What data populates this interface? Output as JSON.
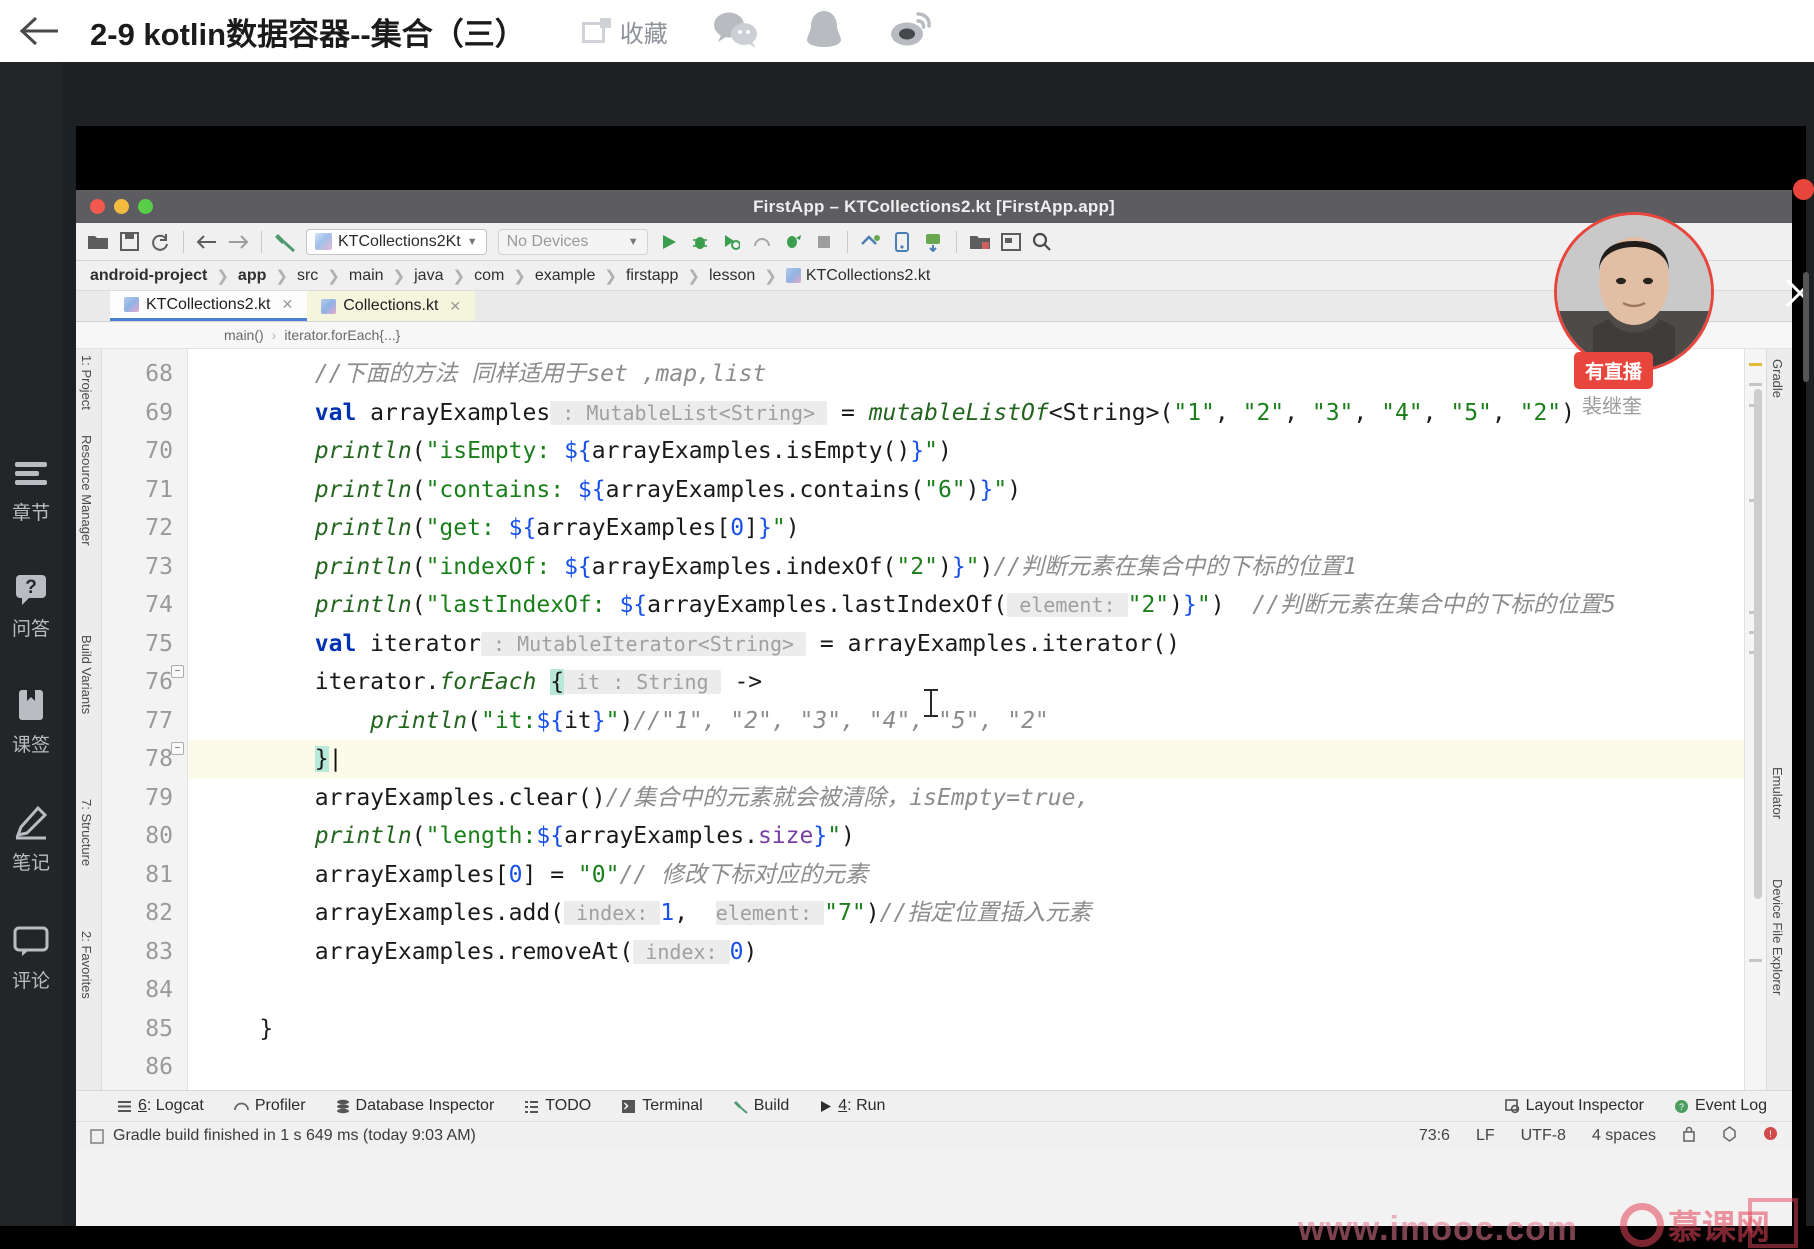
{
  "header": {
    "back_icon": "arrow-left-icon",
    "title": "2-9 kotlin数据容器--集合（三）",
    "favorite_label": "收藏",
    "social": [
      {
        "name": "wechat-icon"
      },
      {
        "name": "qq-icon"
      },
      {
        "name": "weibo-icon"
      }
    ]
  },
  "sidebar": {
    "items": [
      {
        "icon": "chapters-icon",
        "label": "章节"
      },
      {
        "icon": "qa-icon",
        "label": "问答"
      },
      {
        "icon": "bookmark-icon",
        "label": "课签"
      },
      {
        "icon": "notes-icon",
        "label": "笔记"
      },
      {
        "icon": "comments-icon",
        "label": "评论"
      }
    ]
  },
  "overlay": {
    "live_badge": "有直播",
    "presenter_name": "裴继奎",
    "close_icon": "close-icon"
  },
  "ide": {
    "window_title": "FirstApp – KTCollections2.kt [FirstApp.app]",
    "toolbar": {
      "icons": [
        "open-folder-icon",
        "save-icon",
        "sync-icon",
        "back-icon",
        "forward-icon",
        "build-hammer-icon"
      ],
      "run_config": "KTCollections2Kt",
      "device_selector": "No Devices",
      "action_icons": [
        "run-icon",
        "debug-icon",
        "run-coverage-icon",
        "profile-icon",
        "attach-debugger-icon",
        "stop-icon",
        "avd-manager-icon",
        "device-manager-icon",
        "sdk-manager-icon",
        "project-structure-icon",
        "layout-editor-icon",
        "search-icon"
      ]
    },
    "breadcrumbs": [
      "android-project",
      "app",
      "src",
      "main",
      "java",
      "com",
      "example",
      "firstapp",
      "lesson",
      "KTCollections2.kt"
    ],
    "tabs": [
      {
        "label": "KTCollections2.kt",
        "active": true
      },
      {
        "label": "Collections.kt",
        "active": false
      }
    ],
    "structure_path": [
      "main()",
      "iterator.forEach{...}"
    ],
    "left_tool_labels": [
      "1: Project",
      "Resource Manager",
      "Build Variants",
      "7: Structure",
      "2: Favorites"
    ],
    "right_tool_labels": [
      "Gradle",
      "Emulator",
      "Device File Explorer"
    ],
    "bottom_tabs": [
      {
        "num": "6",
        "label": "Logcat",
        "icon": "logcat-icon"
      },
      {
        "num": "",
        "label": "Profiler",
        "icon": "profiler-icon"
      },
      {
        "num": "",
        "label": "Database Inspector",
        "icon": "database-icon"
      },
      {
        "num": "",
        "label": "TODO",
        "icon": "todo-icon"
      },
      {
        "num": "",
        "label": "Terminal",
        "icon": "terminal-icon"
      },
      {
        "num": "",
        "label": "Build",
        "icon": "build-icon"
      },
      {
        "num": "4",
        "label": "Run",
        "icon": "run-icon"
      }
    ],
    "bottom_right": [
      {
        "label": "Layout Inspector",
        "icon": "layout-inspector-icon"
      },
      {
        "label": "Event Log",
        "icon": "event-log-icon"
      }
    ],
    "status_message": "Gradle build finished in 1 s 649 ms (today 9:03 AM)",
    "status_right": {
      "caret": "73:6",
      "line_sep": "LF",
      "encoding": "UTF-8",
      "indent": "4 spaces",
      "lock_icon": "lock-icon",
      "inspector_icon": "inspection-icon",
      "error_icon": "error-icon"
    },
    "editor": {
      "first_line": 68,
      "highlight_line": 78,
      "lines": [
        {
          "n": 68,
          "segments": [
            {
              "t": "        ",
              "c": "plain"
            },
            {
              "t": "//下面的方法 同样适用于set ,map,list",
              "c": "cmt"
            }
          ]
        },
        {
          "n": 69,
          "segments": [
            {
              "t": "        ",
              "c": "plain"
            },
            {
              "t": "val",
              "c": "kw"
            },
            {
              "t": " arrayExamples",
              "c": "plain"
            },
            {
              "t": " : MutableList<String> ",
              "c": "hint"
            },
            {
              "t": " = ",
              "c": "plain"
            },
            {
              "t": "mutableListOf",
              "c": "fn"
            },
            {
              "t": "<String>(",
              "c": "plain"
            },
            {
              "t": "\"1\"",
              "c": "str"
            },
            {
              "t": ", ",
              "c": "plain"
            },
            {
              "t": "\"2\"",
              "c": "str"
            },
            {
              "t": ", ",
              "c": "plain"
            },
            {
              "t": "\"3\"",
              "c": "str"
            },
            {
              "t": ", ",
              "c": "plain"
            },
            {
              "t": "\"4\"",
              "c": "str"
            },
            {
              "t": ", ",
              "c": "plain"
            },
            {
              "t": "\"5\"",
              "c": "str"
            },
            {
              "t": ", ",
              "c": "plain"
            },
            {
              "t": "\"2\"",
              "c": "str"
            },
            {
              "t": ")",
              "c": "plain"
            }
          ]
        },
        {
          "n": 70,
          "segments": [
            {
              "t": "        ",
              "c": "plain"
            },
            {
              "t": "println",
              "c": "fn"
            },
            {
              "t": "(",
              "c": "plain"
            },
            {
              "t": "\"isEmpty: ",
              "c": "str"
            },
            {
              "t": "${",
              "c": "num"
            },
            {
              "t": "arrayExamples.isEmpty()",
              "c": "plain"
            },
            {
              "t": "}",
              "c": "num"
            },
            {
              "t": "\"",
              "c": "str"
            },
            {
              "t": ")",
              "c": "plain"
            }
          ]
        },
        {
          "n": 71,
          "segments": [
            {
              "t": "        ",
              "c": "plain"
            },
            {
              "t": "println",
              "c": "fn"
            },
            {
              "t": "(",
              "c": "plain"
            },
            {
              "t": "\"contains: ",
              "c": "str"
            },
            {
              "t": "${",
              "c": "num"
            },
            {
              "t": "arrayExamples.contains(",
              "c": "plain"
            },
            {
              "t": "\"6\"",
              "c": "str"
            },
            {
              "t": ")",
              "c": "plain"
            },
            {
              "t": "}",
              "c": "num"
            },
            {
              "t": "\"",
              "c": "str"
            },
            {
              "t": ")",
              "c": "plain"
            }
          ]
        },
        {
          "n": 72,
          "segments": [
            {
              "t": "        ",
              "c": "plain"
            },
            {
              "t": "println",
              "c": "fn"
            },
            {
              "t": "(",
              "c": "plain"
            },
            {
              "t": "\"get: ",
              "c": "str"
            },
            {
              "t": "${",
              "c": "num"
            },
            {
              "t": "arrayExamples[",
              "c": "plain"
            },
            {
              "t": "0",
              "c": "num"
            },
            {
              "t": "]",
              "c": "plain"
            },
            {
              "t": "}",
              "c": "num"
            },
            {
              "t": "\"",
              "c": "str"
            },
            {
              "t": ")",
              "c": "plain"
            }
          ]
        },
        {
          "n": 73,
          "segments": [
            {
              "t": "        ",
              "c": "plain"
            },
            {
              "t": "println",
              "c": "fn"
            },
            {
              "t": "(",
              "c": "plain"
            },
            {
              "t": "\"indexOf: ",
              "c": "str"
            },
            {
              "t": "${",
              "c": "num"
            },
            {
              "t": "arrayExamples.indexOf(",
              "c": "plain"
            },
            {
              "t": "\"2\"",
              "c": "str"
            },
            {
              "t": ")",
              "c": "plain"
            },
            {
              "t": "}",
              "c": "num"
            },
            {
              "t": "\"",
              "c": "str"
            },
            {
              "t": ")",
              "c": "plain"
            },
            {
              "t": "//判断元素在集合中的下标的位置1",
              "c": "cmt"
            }
          ]
        },
        {
          "n": 74,
          "segments": [
            {
              "t": "        ",
              "c": "plain"
            },
            {
              "t": "println",
              "c": "fn"
            },
            {
              "t": "(",
              "c": "plain"
            },
            {
              "t": "\"lastIndexOf: ",
              "c": "str"
            },
            {
              "t": "${",
              "c": "num"
            },
            {
              "t": "arrayExamples.lastIndexOf(",
              "c": "plain"
            },
            {
              "t": " element: ",
              "c": "hint"
            },
            {
              "t": "\"2\"",
              "c": "str"
            },
            {
              "t": ")",
              "c": "plain"
            },
            {
              "t": "}",
              "c": "num"
            },
            {
              "t": "\"",
              "c": "str"
            },
            {
              "t": ")  ",
              "c": "plain"
            },
            {
              "t": "//判断元素在集合中的下标的位置5",
              "c": "cmt"
            }
          ]
        },
        {
          "n": 75,
          "segments": [
            {
              "t": "        ",
              "c": "plain"
            },
            {
              "t": "val",
              "c": "kw"
            },
            {
              "t": " iterator",
              "c": "plain"
            },
            {
              "t": " : MutableIterator<String> ",
              "c": "hint"
            },
            {
              "t": " = arrayExamples.iterator()",
              "c": "plain"
            }
          ]
        },
        {
          "n": 76,
          "segments": [
            {
              "t": "        ",
              "c": "plain"
            },
            {
              "t": "iterator.",
              "c": "plain"
            },
            {
              "t": "forEach",
              "c": "fn"
            },
            {
              "t": " ",
              "c": "plain"
            },
            {
              "t": "{",
              "c": "blk"
            },
            {
              "t": " it : String ",
              "c": "hint"
            },
            {
              "t": " ->",
              "c": "plain"
            }
          ]
        },
        {
          "n": 77,
          "segments": [
            {
              "t": "            ",
              "c": "plain"
            },
            {
              "t": "println",
              "c": "fn"
            },
            {
              "t": "(",
              "c": "plain"
            },
            {
              "t": "\"it:",
              "c": "str"
            },
            {
              "t": "${",
              "c": "num"
            },
            {
              "t": "it",
              "c": "plain"
            },
            {
              "t": "}",
              "c": "num"
            },
            {
              "t": "\"",
              "c": "str"
            },
            {
              "t": ")",
              "c": "plain"
            },
            {
              "t": "//\"1\", \"2\", \"3\", \"4\", \"5\", \"2\"",
              "c": "cmt"
            }
          ]
        },
        {
          "n": 78,
          "segments": [
            {
              "t": "        ",
              "c": "plain"
            },
            {
              "t": "}",
              "c": "blk"
            }
          ]
        },
        {
          "n": 79,
          "segments": [
            {
              "t": "        ",
              "c": "plain"
            },
            {
              "t": "arrayExamples.clear()",
              "c": "plain"
            },
            {
              "t": "//集合中的元素就会被清除，isEmpty=true,",
              "c": "cmt"
            }
          ]
        },
        {
          "n": 80,
          "segments": [
            {
              "t": "        ",
              "c": "plain"
            },
            {
              "t": "println",
              "c": "fn"
            },
            {
              "t": "(",
              "c": "plain"
            },
            {
              "t": "\"length:",
              "c": "str"
            },
            {
              "t": "${",
              "c": "num"
            },
            {
              "t": "arrayExamples.",
              "c": "plain"
            },
            {
              "t": "size",
              "c": "prop"
            },
            {
              "t": "}",
              "c": "num"
            },
            {
              "t": "\"",
              "c": "str"
            },
            {
              "t": ")",
              "c": "plain"
            }
          ]
        },
        {
          "n": 81,
          "segments": [
            {
              "t": "        ",
              "c": "plain"
            },
            {
              "t": "arrayExamples[",
              "c": "plain"
            },
            {
              "t": "0",
              "c": "num"
            },
            {
              "t": "] = ",
              "c": "plain"
            },
            {
              "t": "\"0\"",
              "c": "str"
            },
            {
              "t": "// 修改下标对应的元素",
              "c": "cmt"
            }
          ]
        },
        {
          "n": 82,
          "segments": [
            {
              "t": "        ",
              "c": "plain"
            },
            {
              "t": "arrayExamples.add(",
              "c": "plain"
            },
            {
              "t": " index: ",
              "c": "hint"
            },
            {
              "t": "1",
              "c": "num"
            },
            {
              "t": ",  ",
              "c": "plain"
            },
            {
              "t": "element: ",
              "c": "hint"
            },
            {
              "t": "\"7\"",
              "c": "str"
            },
            {
              "t": ")",
              "c": "plain"
            },
            {
              "t": "//指定位置插入元素",
              "c": "cmt"
            }
          ]
        },
        {
          "n": 83,
          "segments": [
            {
              "t": "        ",
              "c": "plain"
            },
            {
              "t": "arrayExamples.removeAt(",
              "c": "plain"
            },
            {
              "t": " index: ",
              "c": "hint"
            },
            {
              "t": "0",
              "c": "num"
            },
            {
              "t": ")",
              "c": "plain"
            }
          ]
        },
        {
          "n": 84,
          "segments": [
            {
              "t": "",
              "c": "plain"
            }
          ]
        },
        {
          "n": 85,
          "segments": [
            {
              "t": "    ",
              "c": "plain"
            },
            {
              "t": "}",
              "c": "plain"
            }
          ]
        },
        {
          "n": 86,
          "segments": [
            {
              "t": "",
              "c": "plain"
            }
          ]
        }
      ]
    }
  },
  "watermark": {
    "url": "www.imooc.com",
    "brand": "慕课网"
  },
  "colors": {
    "accent_red": "#e8453c",
    "ide_titlebar": "#5c5c61",
    "keyword_blue": "#0033b3",
    "string_green": "#1a7f1a",
    "comment_gray": "#8c8c8c",
    "highlight_line": "#fcfae8"
  }
}
